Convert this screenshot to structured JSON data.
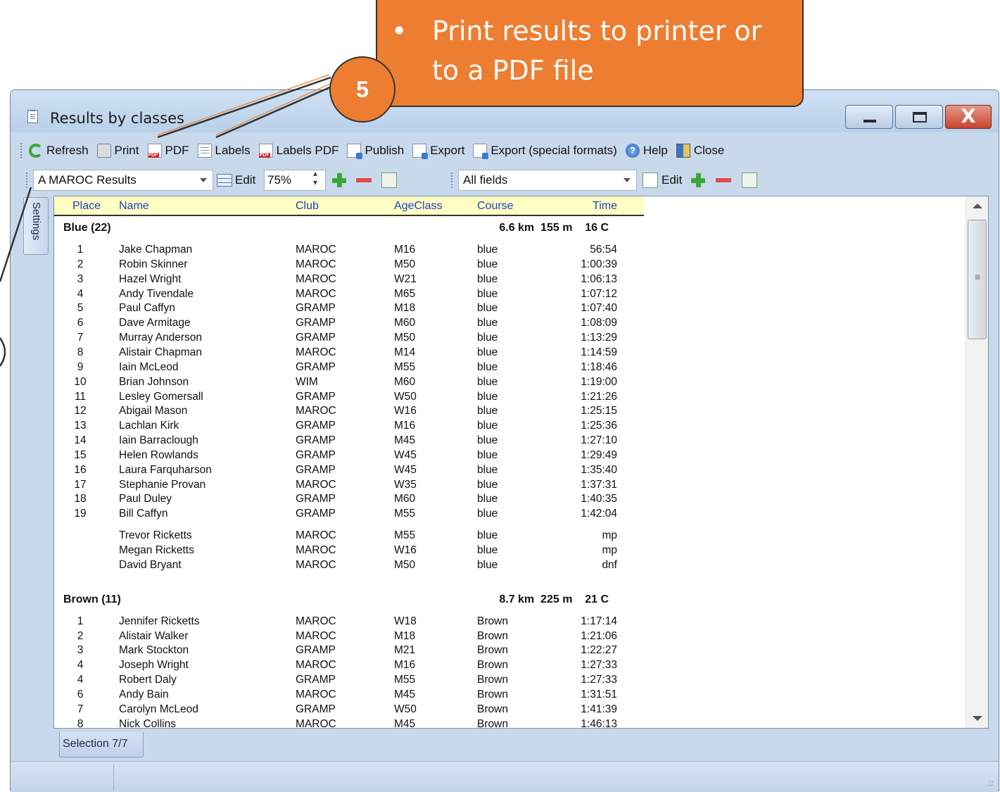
{
  "window": {
    "title": "Results by classes",
    "min_glyph": "",
    "max_glyph": "",
    "close_glyph": "X"
  },
  "toolbar": {
    "refresh": "Refresh",
    "print": "Print",
    "pdf": "PDF",
    "labels": "Labels",
    "labels_pdf": "Labels PDF",
    "publish": "Publish",
    "export": "Export",
    "export_special": "Export (special formats)",
    "help": "Help",
    "close": "Close"
  },
  "toolbar2": {
    "report_selected": "A MAROC Results",
    "edit_label": "Edit",
    "zoom": "75%",
    "fields_selected": "All fields",
    "edit2_label": "Edit"
  },
  "side_tab": "Settings",
  "columns": {
    "place": "Place",
    "name": "Name",
    "club": "Club",
    "ageclass": "AgeClass",
    "course": "Course",
    "time": "Time"
  },
  "groups": [
    {
      "title": "Blue  (22)",
      "info": "6.6 km  155 m    16 C",
      "rows": [
        {
          "place": "1",
          "name": "Jake Chapman",
          "club": "MAROC",
          "age": "M16",
          "course": "blue",
          "time": "56:54"
        },
        {
          "place": "2",
          "name": "Robin Skinner",
          "club": "MAROC",
          "age": "M50",
          "course": "blue",
          "time": "1:00:39"
        },
        {
          "place": "3",
          "name": "Hazel Wright",
          "club": "MAROC",
          "age": "W21",
          "course": "blue",
          "time": "1:06:13"
        },
        {
          "place": "4",
          "name": "Andy Tivendale",
          "club": "MAROC",
          "age": "M65",
          "course": "blue",
          "time": "1:07:12"
        },
        {
          "place": "5",
          "name": "Paul Caffyn",
          "club": "GRAMP",
          "age": "M18",
          "course": "blue",
          "time": "1:07:40"
        },
        {
          "place": "6",
          "name": "Dave Armitage",
          "club": "GRAMP",
          "age": "M60",
          "course": "blue",
          "time": "1:08:09"
        },
        {
          "place": "7",
          "name": "Murray Anderson",
          "club": "GRAMP",
          "age": "M50",
          "course": "blue",
          "time": "1:13:29"
        },
        {
          "place": "8",
          "name": "Alistair Chapman",
          "club": "MAROC",
          "age": "M14",
          "course": "blue",
          "time": "1:14:59"
        },
        {
          "place": "9",
          "name": "Iain McLeod",
          "club": "GRAMP",
          "age": "M55",
          "course": "blue",
          "time": "1:18:46"
        },
        {
          "place": "10",
          "name": "Brian Johnson",
          "club": "WIM",
          "age": "M60",
          "course": "blue",
          "time": "1:19:00"
        },
        {
          "place": "11",
          "name": "Lesley Gomersall",
          "club": "GRAMP",
          "age": "W50",
          "course": "blue",
          "time": "1:21:26"
        },
        {
          "place": "12",
          "name": "Abigail Mason",
          "club": "MAROC",
          "age": "W16",
          "course": "blue",
          "time": "1:25:15"
        },
        {
          "place": "13",
          "name": "Lachlan Kirk",
          "club": "GRAMP",
          "age": "M16",
          "course": "blue",
          "time": "1:25:36"
        },
        {
          "place": "14",
          "name": "Iain Barraclough",
          "club": "GRAMP",
          "age": "M45",
          "course": "blue",
          "time": "1:27:10"
        },
        {
          "place": "15",
          "name": "Helen Rowlands",
          "club": "GRAMP",
          "age": "W45",
          "course": "blue",
          "time": "1:29:49"
        },
        {
          "place": "16",
          "name": "Laura Farquharson",
          "club": "GRAMP",
          "age": "W45",
          "course": "blue",
          "time": "1:35:40"
        },
        {
          "place": "17",
          "name": "Stephanie Provan",
          "club": "MAROC",
          "age": "W35",
          "course": "blue",
          "time": "1:37:31"
        },
        {
          "place": "18",
          "name": "Paul Duley",
          "club": "GRAMP",
          "age": "M60",
          "course": "blue",
          "time": "1:40:35"
        },
        {
          "place": "19",
          "name": "Bill Caffyn",
          "club": "GRAMP",
          "age": "M55",
          "course": "blue",
          "time": "1:42:04"
        },
        {
          "place": "",
          "name": "Trevor Ricketts",
          "club": "MAROC",
          "age": "M55",
          "course": "blue",
          "time": "mp"
        },
        {
          "place": "",
          "name": "Megan Ricketts",
          "club": "MAROC",
          "age": "W16",
          "course": "blue",
          "time": "mp"
        },
        {
          "place": "",
          "name": "David Bryant",
          "club": "MAROC",
          "age": "M50",
          "course": "blue",
          "time": "dnf"
        }
      ]
    },
    {
      "title": "Brown  (11)",
      "info": "8.7 km  225 m    21 C",
      "rows": [
        {
          "place": "1",
          "name": "Jennifer Ricketts",
          "club": "MAROC",
          "age": "W18",
          "course": "Brown",
          "time": "1:17:14"
        },
        {
          "place": "2",
          "name": "Alistair Walker",
          "club": "MAROC",
          "age": "M18",
          "course": "Brown",
          "time": "1:21:06"
        },
        {
          "place": "3",
          "name": "Mark Stockton",
          "club": "GRAMP",
          "age": "M21",
          "course": "Brown",
          "time": "1:22:27"
        },
        {
          "place": "4",
          "name": "Joseph Wright",
          "club": "MAROC",
          "age": "M16",
          "course": "Brown",
          "time": "1:27:33"
        },
        {
          "place": "4",
          "name": "Robert Daly",
          "club": "GRAMP",
          "age": "M55",
          "course": "Brown",
          "time": "1:27:33"
        },
        {
          "place": "6",
          "name": "Andy Bain",
          "club": "MAROC",
          "age": "M45",
          "course": "Brown",
          "time": "1:31:51"
        },
        {
          "place": "7",
          "name": "Carolyn McLeod",
          "club": "GRAMP",
          "age": "W50",
          "course": "Brown",
          "time": "1:41:39"
        },
        {
          "place": "8",
          "name": "Nick Collins",
          "club": "MAROC",
          "age": "M45",
          "course": "Brown",
          "time": "1:46:13"
        }
      ]
    }
  ],
  "bottom_tab": "Selection  7/7",
  "callout": {
    "bullet": "•",
    "line1": "Print results to printer or",
    "line2": "to a PDF file",
    "badge": "5",
    "fill_color": "#ed7d31"
  }
}
